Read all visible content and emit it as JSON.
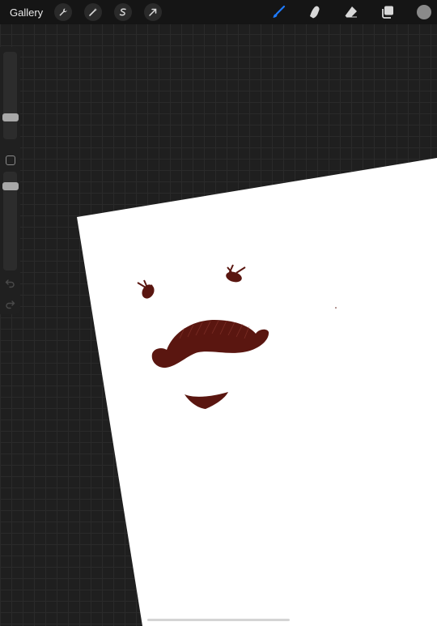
{
  "topbar": {
    "gallery_label": "Gallery",
    "left_tools": [
      {
        "name": "actions",
        "icon": "wrench-icon"
      },
      {
        "name": "adjustments",
        "icon": "magic-wand-icon"
      },
      {
        "name": "selection",
        "icon": "selection-s-icon"
      },
      {
        "name": "transform",
        "icon": "arrow-cursor-icon"
      }
    ],
    "right_tools": [
      {
        "name": "brush",
        "icon": "brush-icon",
        "active": true,
        "color": "#1e7bff"
      },
      {
        "name": "smudge",
        "icon": "smudge-finger-icon",
        "active": false
      },
      {
        "name": "eraser",
        "icon": "eraser-icon",
        "active": false
      },
      {
        "name": "layers",
        "icon": "layers-icon",
        "active": false
      }
    ],
    "current_color": "#8a8a8a"
  },
  "sidebar": {
    "brush_size_level": 0.2,
    "brush_opacity_level": 0.96,
    "buttons": [
      "modify-square-icon",
      "undo-icon",
      "redo-icon"
    ]
  },
  "canvas": {
    "background": "#ffffff",
    "ink_color": "#5a1610"
  }
}
